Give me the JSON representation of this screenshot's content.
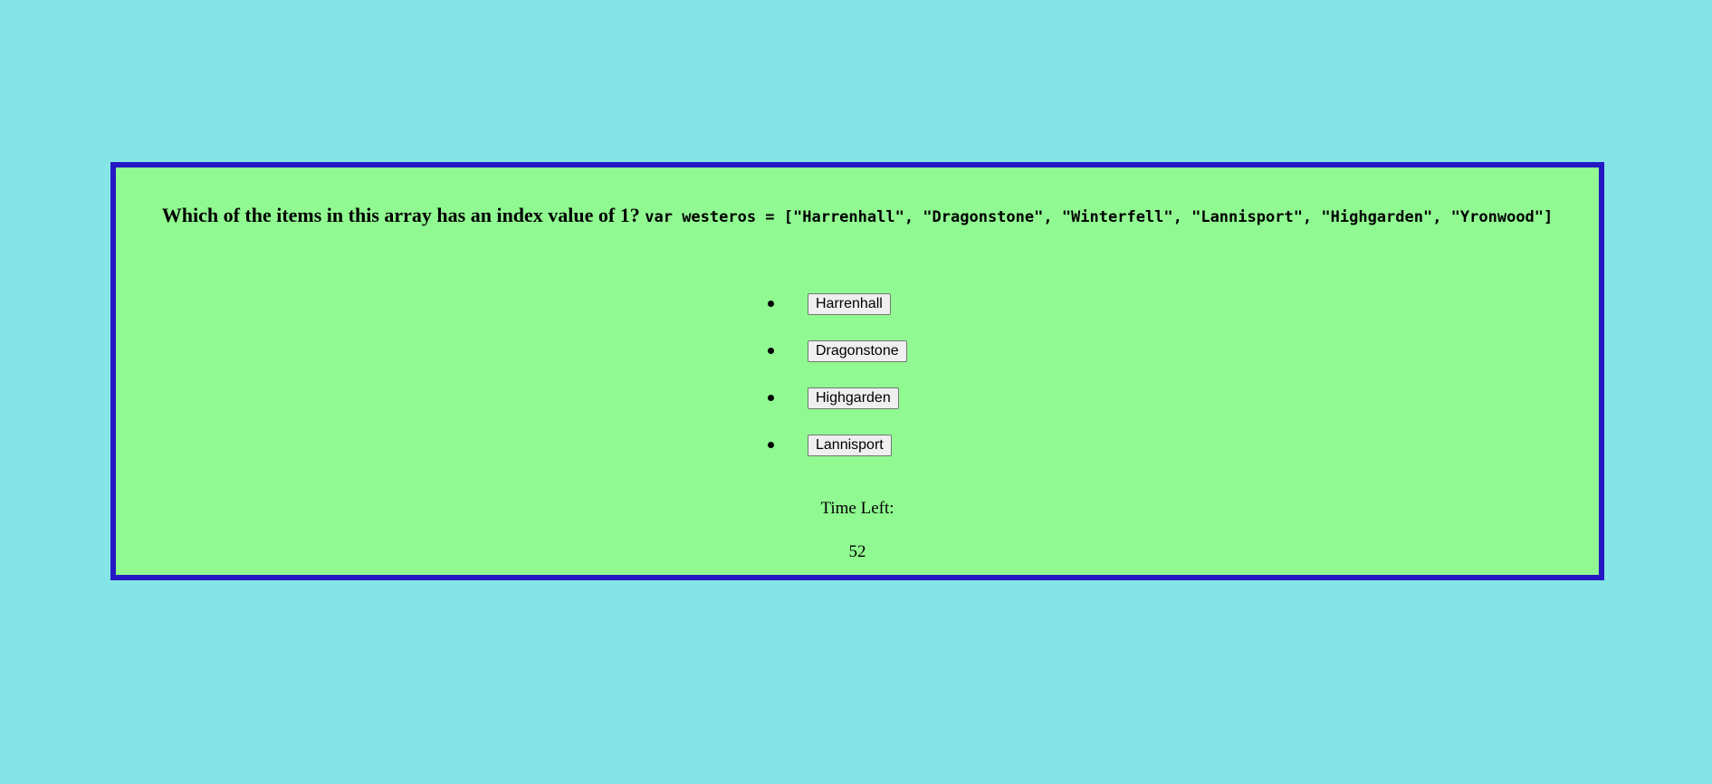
{
  "colors": {
    "page_background": "#85e4e5",
    "panel_background": "#90f991",
    "panel_border": "#2617c4"
  },
  "question": {
    "text": "Which of the items in this array has an index value of 1?",
    "code": "var westeros = [\"Harrenhall\", \"Dragonstone\", \"Winterfell\", \"Lannisport\", \"Highgarden\", \"Yronwood\"]"
  },
  "answers": [
    {
      "label": "Harrenhall"
    },
    {
      "label": "Dragonstone"
    },
    {
      "label": "Highgarden"
    },
    {
      "label": "Lannisport"
    }
  ],
  "timer": {
    "label": "Time Left:",
    "value": "52"
  }
}
